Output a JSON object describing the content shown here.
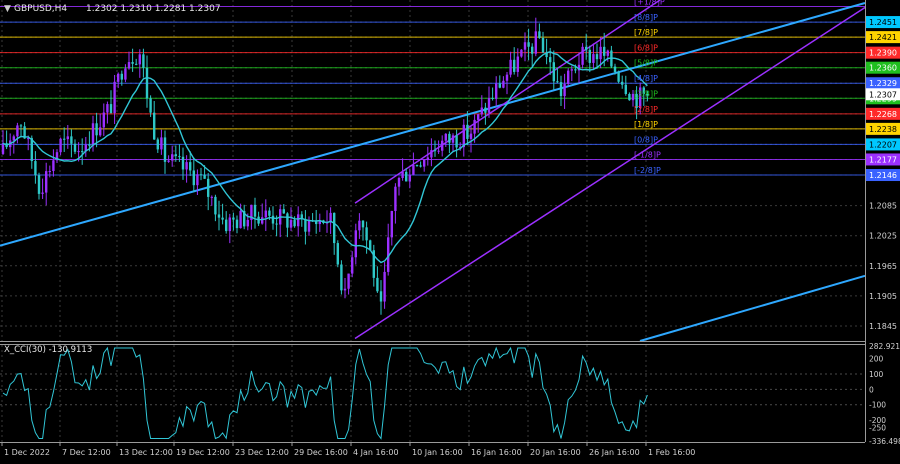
{
  "chart_data": [
    {
      "type": "candlestick",
      "title": "GBPUSD,H4",
      "ohlc": "1.2302 1.2310 1.2281 1.2307",
      "ylim": [
        1.1815,
        1.2495
      ],
      "y_ticks": [
        "1.2451",
        "1.2421",
        "1.2390",
        "1.2360",
        "1.2329",
        "1.2299",
        "1.2268",
        "1.2238",
        "1.2207",
        "1.2177",
        "1.2146",
        "1.2085",
        "1.2025",
        "1.1965",
        "1.1905",
        "1.1845"
      ],
      "x_ticks": [
        "1 Dec 2022",
        "7 Dec 12:00",
        "13 Dec 12:00",
        "19 Dec 12:00",
        "23 Dec 12:00",
        "29 Dec 16:00",
        "4 Jan 16:00",
        "10 Jan 16:00",
        "16 Jan 16:00",
        "20 Jan 16:00",
        "26 Jan 16:00",
        "1 Feb 16:00"
      ],
      "current_price": "1.2307",
      "murrey_levels": [
        {
          "label": "[+1/8]P",
          "value": 1.2482,
          "color": "#9b30ff"
        },
        {
          "label": "[8/8]P",
          "value": 1.2451,
          "color": "#3a62ff"
        },
        {
          "label": "[7/8]P",
          "value": 1.2421,
          "color": "#ffd400"
        },
        {
          "label": "[6/8]P",
          "value": 1.239,
          "color": "#ff2a2a"
        },
        {
          "label": "[5/8]P",
          "value": 1.236,
          "color": "#1fbf1f"
        },
        {
          "label": "[4/8]P",
          "value": 1.2329,
          "color": "#3a62ff"
        },
        {
          "label": "[3/8]P",
          "value": 1.2299,
          "color": "#1fbf1f"
        },
        {
          "label": "[2/8]P",
          "value": 1.2268,
          "color": "#ff2a2a"
        },
        {
          "label": "[1/8]P",
          "value": 1.2238,
          "color": "#ffd400"
        },
        {
          "label": "[0/8]P",
          "value": 1.2207,
          "color": "#3a62ff"
        },
        {
          "label": "[-1/8]P",
          "value": 1.2177,
          "color": "#9b30ff"
        },
        {
          "label": "[-2/8]P",
          "value": 1.2146,
          "color": "#3a62ff"
        }
      ],
      "indicator": {
        "name": "X_CCI(30) -130.9113",
        "ylim": [
          -336.4986,
          282.9211
        ],
        "y_ticks": [
          "282.9211",
          "200",
          "100",
          "0",
          "-100",
          "-200",
          "-250",
          "-336.4986"
        ],
        "current": "-130.9113"
      }
    }
  ]
}
